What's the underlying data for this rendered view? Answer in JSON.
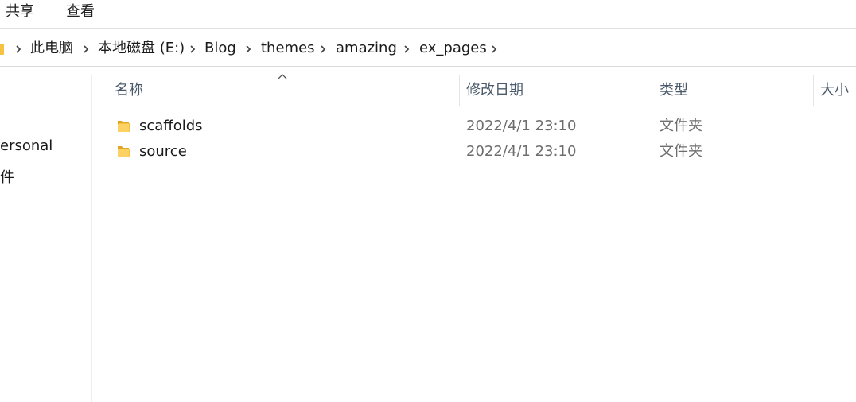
{
  "ribbon": {
    "tabs": [
      "共享",
      "查看"
    ]
  },
  "address_bar": {
    "segments": [
      "此电脑",
      "本地磁盘 (E:)",
      "Blog",
      "themes",
      "amazing",
      "ex_pages"
    ]
  },
  "nav_pane": {
    "items": [
      "ersonal",
      "件"
    ]
  },
  "columns": {
    "name": "名称",
    "date": "修改日期",
    "type": "类型",
    "size": "大小"
  },
  "files": [
    {
      "name": "scaffolds",
      "date": "2022/4/1 23:10",
      "type": "文件夹",
      "icon": "folder-icon"
    },
    {
      "name": "source",
      "date": "2022/4/1 23:10",
      "type": "文件夹",
      "icon": "folder-icon"
    }
  ],
  "colors": {
    "folder": "#f5c242",
    "folder_dark": "#e0a526",
    "header_text": "#4a5a6a",
    "meta_text": "#6d6d6d"
  }
}
